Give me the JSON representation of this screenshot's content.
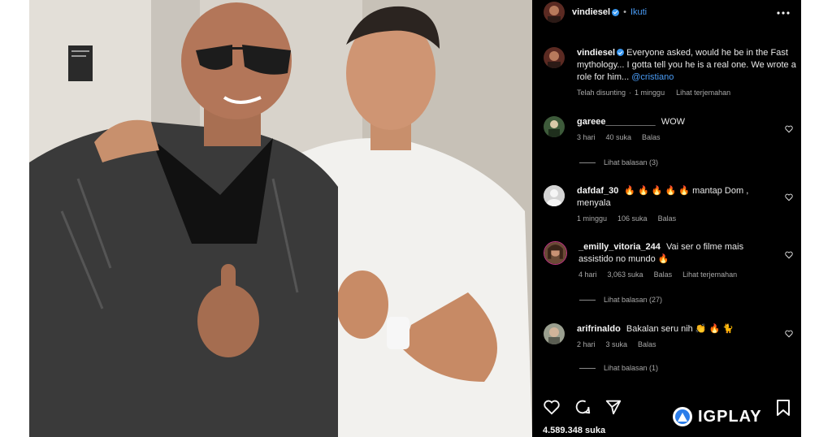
{
  "header": {
    "username": "vindiesel",
    "follow_label": "Ikuti",
    "more_icon": "ellipsis-icon"
  },
  "caption": {
    "username": "vindiesel",
    "text": "Everyone asked, would he be in the Fast mythology... I gotta tell you he is a real one. We wrote a role for him...",
    "mention": "@cristiano",
    "edited_label": "Telah disunting",
    "time": "1 minggu",
    "translate_label": "Lihat terjemahan"
  },
  "comments": [
    {
      "username": "gareee__________",
      "text": "WOW",
      "time": "3 hari",
      "likes": "40 suka",
      "reply_label": "Balas",
      "view_replies": "Lihat balasan (3)"
    },
    {
      "username": "dafdaf_30",
      "text": "🔥 🔥 🔥 🔥 🔥  mantap Dom , menyala",
      "time": "1 minggu",
      "likes": "106 suka",
      "reply_label": "Balas"
    },
    {
      "username": "_emilly_vitoria_244",
      "text": "Vai ser o filme mais assistido no mundo 🔥",
      "time": "4 hari",
      "likes": "3,063 suka",
      "reply_label": "Balas",
      "translate_label": "Lihat terjemahan",
      "view_replies": "Lihat balasan (27)"
    },
    {
      "username": "arifrinaldo",
      "text": "Bakalan seru nih 👏 🔥 🐈",
      "time": "2 hari",
      "likes": "3 suka",
      "reply_label": "Balas",
      "view_replies": "Lihat balasan (1)"
    }
  ],
  "footer": {
    "likes": "4.589.348 suka"
  },
  "watermark": {
    "text": "IGPLAY"
  },
  "colors": {
    "background": "#000000",
    "link": "#4a9cf6",
    "verified": "#3897f0",
    "secondary_text": "#a8a8a8"
  }
}
